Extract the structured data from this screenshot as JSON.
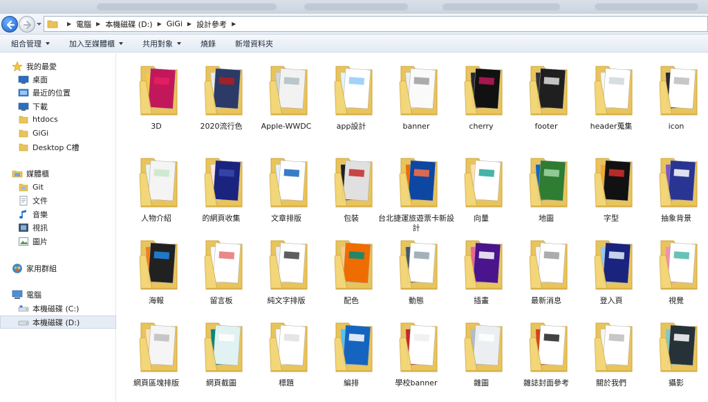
{
  "address": {
    "crumbs": [
      "電腦",
      "本機磁碟 (D:)",
      "GiGi",
      "設計參考"
    ]
  },
  "toolbar": {
    "organize": "組合管理",
    "add_library": "加入至媒體櫃",
    "share": "共用對象",
    "burn": "燒錄",
    "new_folder": "新增資料夾"
  },
  "nav": {
    "favorites": "我的最愛",
    "desktop": "桌面",
    "recent": "最近的位置",
    "downloads": "下載",
    "htdocs": "htdocs",
    "gigi": "GiGi",
    "desktop_c": "Desktop C槽",
    "libraries": "媒體櫃",
    "git": "Git",
    "documents": "文件",
    "music": "音樂",
    "videos": "視訊",
    "pictures": "圖片",
    "homegroup": "家用群組",
    "computer": "電腦",
    "drive_c": "本機磁碟 (C:)",
    "drive_d": "本機磁碟 (D:)"
  },
  "folders": [
    {
      "name": "3D",
      "palette": [
        "#c2185b",
        "#f7c948",
        "#e91e63"
      ]
    },
    {
      "name": "2020流行色",
      "palette": [
        "#2b3a67",
        "#e8e8ee",
        "#b71c1c"
      ]
    },
    {
      "name": "Apple-WWDC",
      "palette": [
        "#f2f2f2",
        "#cfd8dc",
        "#b0bec5"
      ]
    },
    {
      "name": "app設計",
      "palette": [
        "#ffffff",
        "#e3f2fd",
        "#90caf9"
      ]
    },
    {
      "name": "banner",
      "palette": [
        "#fafafa",
        "#eeeeee",
        "#9e9e9e"
      ]
    },
    {
      "name": "cherry",
      "palette": [
        "#111111",
        "#2a2a2a",
        "#c2185b"
      ]
    },
    {
      "name": "footer",
      "palette": [
        "#1f1f1f",
        "#333333",
        "#e0e0e0"
      ]
    },
    {
      "name": "header蒐集",
      "palette": [
        "#ffffff",
        "#f5f5f5",
        "#cfd8dc"
      ]
    },
    {
      "name": "icon",
      "palette": [
        "#ffffff",
        "#2b2b2b",
        "#bdbdbd"
      ]
    },
    {
      "name": "人物介紹",
      "palette": [
        "#f4f4f4",
        "#e8f5e9",
        "#c8e6c9"
      ]
    },
    {
      "name": "的網頁收集",
      "palette": [
        "#1a237e",
        "#fce4ec",
        "#3949ab"
      ]
    },
    {
      "name": "文章排版",
      "palette": [
        "#ffffff",
        "#e3f2fd",
        "#1565c0"
      ]
    },
    {
      "name": "包裝",
      "palette": [
        "#e0e0e0",
        "#212121",
        "#c62828"
      ]
    },
    {
      "name": "台北捷運旅遊票卡新設計",
      "palette": [
        "#0d47a1",
        "#ef6c00",
        "#ff7043"
      ]
    },
    {
      "name": "向量",
      "palette": [
        "#ffffff",
        "#ffe0b2",
        "#26a69a"
      ]
    },
    {
      "name": "地圖",
      "palette": [
        "#2e7d32",
        "#1565c0",
        "#a5d6a7"
      ]
    },
    {
      "name": "字型",
      "palette": [
        "#111111",
        "#f9a825",
        "#d32f2f"
      ]
    },
    {
      "name": "抽象背景",
      "palette": [
        "#283593",
        "#7e57c2",
        "#ffffff"
      ]
    },
    {
      "name": "海報",
      "palette": [
        "#212121",
        "#f57f17",
        "#1e88e5"
      ]
    },
    {
      "name": "留言板",
      "palette": [
        "#ffffff",
        "#fafafa",
        "#e57373"
      ]
    },
    {
      "name": "純文字排版",
      "palette": [
        "#ffffff",
        "#eeeeee",
        "#424242"
      ]
    },
    {
      "name": "配色",
      "palette": [
        "#ef6c00",
        "#ffcc80",
        "#00897b"
      ]
    },
    {
      "name": "動態",
      "palette": [
        "#ffffff",
        "#455a64",
        "#90a4ae"
      ]
    },
    {
      "name": "插畫",
      "palette": [
        "#4a148c",
        "#f06292",
        "#ffffff"
      ]
    },
    {
      "name": "最新消息",
      "palette": [
        "#ffffff",
        "#f5f5f5",
        "#9e9e9e"
      ]
    },
    {
      "name": "登入頁",
      "palette": [
        "#1a237e",
        "#90caf9",
        "#e3f2fd"
      ]
    },
    {
      "name": "視覺",
      "palette": [
        "#ffffff",
        "#f48fb1",
        "#4db6ac"
      ]
    },
    {
      "name": "網頁區塊排版",
      "palette": [
        "#f5f5f5",
        "#ffe0b2",
        "#bdbdbd"
      ]
    },
    {
      "name": "網頁截圖",
      "palette": [
        "#e0f2f1",
        "#00897b",
        "#ffffff"
      ]
    },
    {
      "name": "標題",
      "palette": [
        "#ffffff",
        "#fafafa",
        "#e0e0e0"
      ]
    },
    {
      "name": "編排",
      "palette": [
        "#1565c0",
        "#4fc3f7",
        "#ffffff"
      ]
    },
    {
      "name": "學校banner",
      "palette": [
        "#ffffff",
        "#c62828",
        "#eeeeee"
      ]
    },
    {
      "name": "雜圖",
      "palette": [
        "#eceff1",
        "#b0bec5",
        "#ffffff"
      ]
    },
    {
      "name": "雜誌封面參考",
      "palette": [
        "#ffffff",
        "#d84315",
        "#212121"
      ]
    },
    {
      "name": "關於我們",
      "palette": [
        "#ffffff",
        "#f5f5f5",
        "#bdbdbd"
      ]
    },
    {
      "name": "攝影",
      "palette": [
        "#263238",
        "#80cbc4",
        "#ffffff"
      ]
    }
  ]
}
